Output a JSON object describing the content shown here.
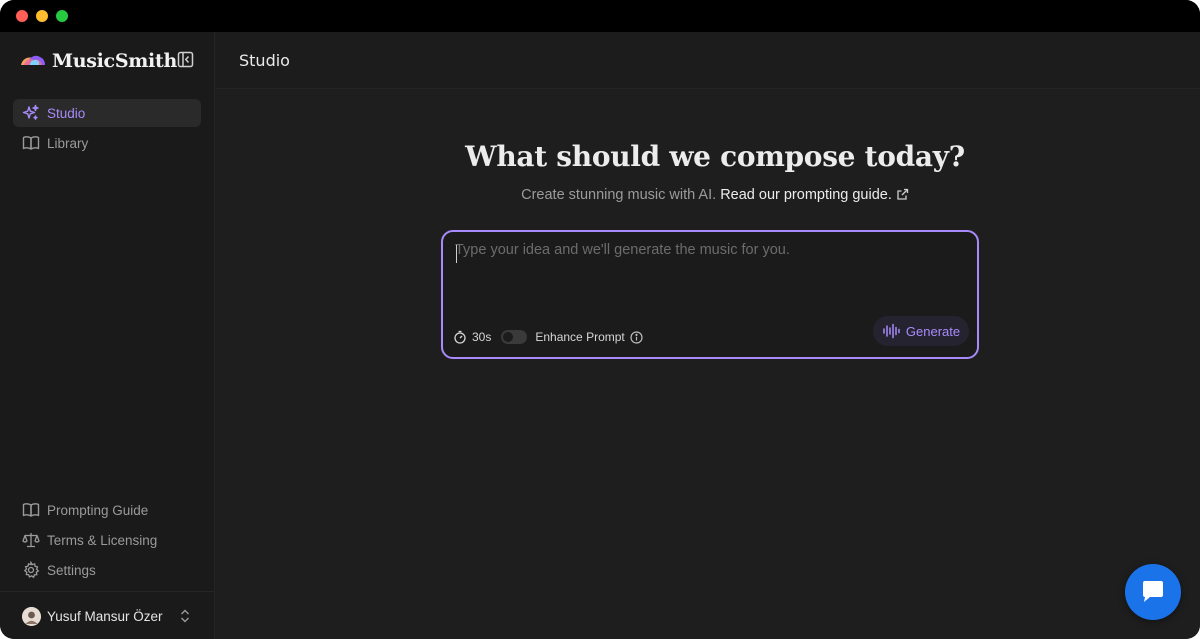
{
  "app": {
    "name": "MusicSmith",
    "accent_color": "#a78bfa",
    "chat_color": "#1a73e8"
  },
  "sidebar": {
    "nav": [
      {
        "label": "Studio",
        "icon": "sparkles-icon",
        "active": true
      },
      {
        "label": "Library",
        "icon": "book-icon",
        "active": false
      }
    ],
    "footer_nav": [
      {
        "label": "Prompting Guide",
        "icon": "book-icon"
      },
      {
        "label": "Terms & Licensing",
        "icon": "scale-icon"
      },
      {
        "label": "Settings",
        "icon": "gear-icon"
      }
    ],
    "user": {
      "name": "Yusuf Mansur Özer"
    }
  },
  "topbar": {
    "title": "Studio"
  },
  "main": {
    "headline": "What should we compose today?",
    "subline": "Create stunning music with AI.",
    "guide_link": "Read our prompting guide.",
    "prompt": {
      "placeholder": "Type your idea and we'll generate the music for you.",
      "value": "",
      "duration": "30s",
      "enhance_label": "Enhance Prompt",
      "enhance_on": false,
      "generate_label": "Generate"
    }
  }
}
